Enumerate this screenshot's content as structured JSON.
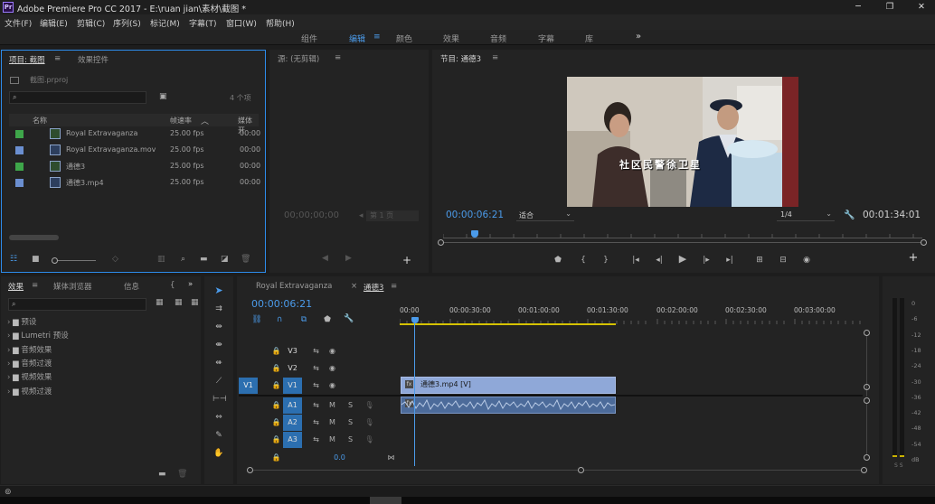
{
  "window": {
    "title": "Adobe Premiere Pro CC 2017 - E:\\ruan jian\\素材\\截图 *"
  },
  "menu": [
    "文件(F)",
    "编辑(E)",
    "剪辑(C)",
    "序列(S)",
    "标记(M)",
    "字幕(T)",
    "窗口(W)",
    "帮助(H)"
  ],
  "workspaces": {
    "tabs": [
      "组件",
      "编辑",
      "颜色",
      "效果",
      "音频",
      "字幕",
      "库"
    ],
    "active": "编辑",
    "more": "»"
  },
  "project": {
    "tab_project": "项目: 截图",
    "tab_effect_controls": "效果控件",
    "file": "截图.prproj",
    "item_count": "4 个项",
    "col_name": "名称",
    "col_fps": "帧速率",
    "col_media": "媒体开",
    "items": [
      {
        "name": "Royal Extravaganza",
        "fps": "25.00 fps",
        "media": "00:00",
        "color": "#3ea64a",
        "kind": "sequence"
      },
      {
        "name": "Royal Extravaganza.mov",
        "fps": "25.00 fps",
        "media": "00:00",
        "color": "#6b8fd0",
        "kind": "clip"
      },
      {
        "name": "通德3",
        "fps": "25.00 fps",
        "media": "00:00",
        "color": "#3ea64a",
        "kind": "sequence"
      },
      {
        "name": "通德3.mp4",
        "fps": "25.00 fps",
        "media": "00:00",
        "color": "#6b8fd0",
        "kind": "clip"
      }
    ]
  },
  "source": {
    "tab": "源: (无剪辑)",
    "timecode": "00;00;00;00",
    "page": "第 1 页"
  },
  "program": {
    "tab": "节目: 通德3",
    "timecode": "00:00:06:21",
    "fit": "适合",
    "ratio": "1/4",
    "duration": "00:01:34:01",
    "caption": "社区民警徐卫星"
  },
  "effects": {
    "tabs": [
      "效果",
      "媒体浏览器",
      "信息",
      "{"
    ],
    "folders": [
      "预设",
      "Lumetri 预设",
      "音频效果",
      "音频过渡",
      "视频效果",
      "视频过渡"
    ]
  },
  "timeline": {
    "tab_other": "Royal Extravaganza",
    "tab_active": "通德3",
    "timecode": "00:00:06:21",
    "ruler": [
      "00:00",
      "00:00:30:00",
      "00:01:00:00",
      "00:01:30:00",
      "00:02:00:00",
      "00:02:30:00",
      "00:03:00:00"
    ],
    "video_tracks": [
      "V3",
      "V2",
      "V1"
    ],
    "audio_tracks": [
      "A1",
      "A2",
      "A3"
    ],
    "target_video": "V1",
    "master_level": "0.0",
    "video_clip": "通德3.mp4 [V]"
  },
  "meter": {
    "ticks": [
      "0",
      "-6",
      "-12",
      "-18",
      "-24",
      "-30",
      "-36",
      "-42",
      "-48",
      "-54",
      "dB"
    ],
    "solo": "S S"
  }
}
